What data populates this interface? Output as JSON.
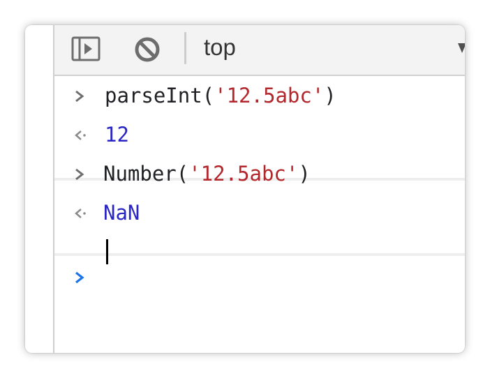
{
  "toolbar": {
    "sidebar_icon": "sidebar-toggle-icon",
    "clear_icon": "clear-console-icon",
    "context": "top",
    "dropdown_icon": "triangle-down-icon"
  },
  "console": {
    "entries": [
      {
        "kind": "input",
        "fn": "parseInt(",
        "arg": "'12.5abc'",
        "close": ")"
      },
      {
        "kind": "output",
        "value": "12"
      },
      {
        "kind": "input",
        "fn": "Number(",
        "arg": "'12.5abc'",
        "close": ")"
      },
      {
        "kind": "output",
        "value": "NaN"
      }
    ],
    "prompt_icon": "chevron-right-icon",
    "input_value": ""
  },
  "colors": {
    "string": "#b3262b",
    "result": "#2a26c4",
    "prompt": "#1a73e8",
    "chevron": "#6e6e6e"
  }
}
